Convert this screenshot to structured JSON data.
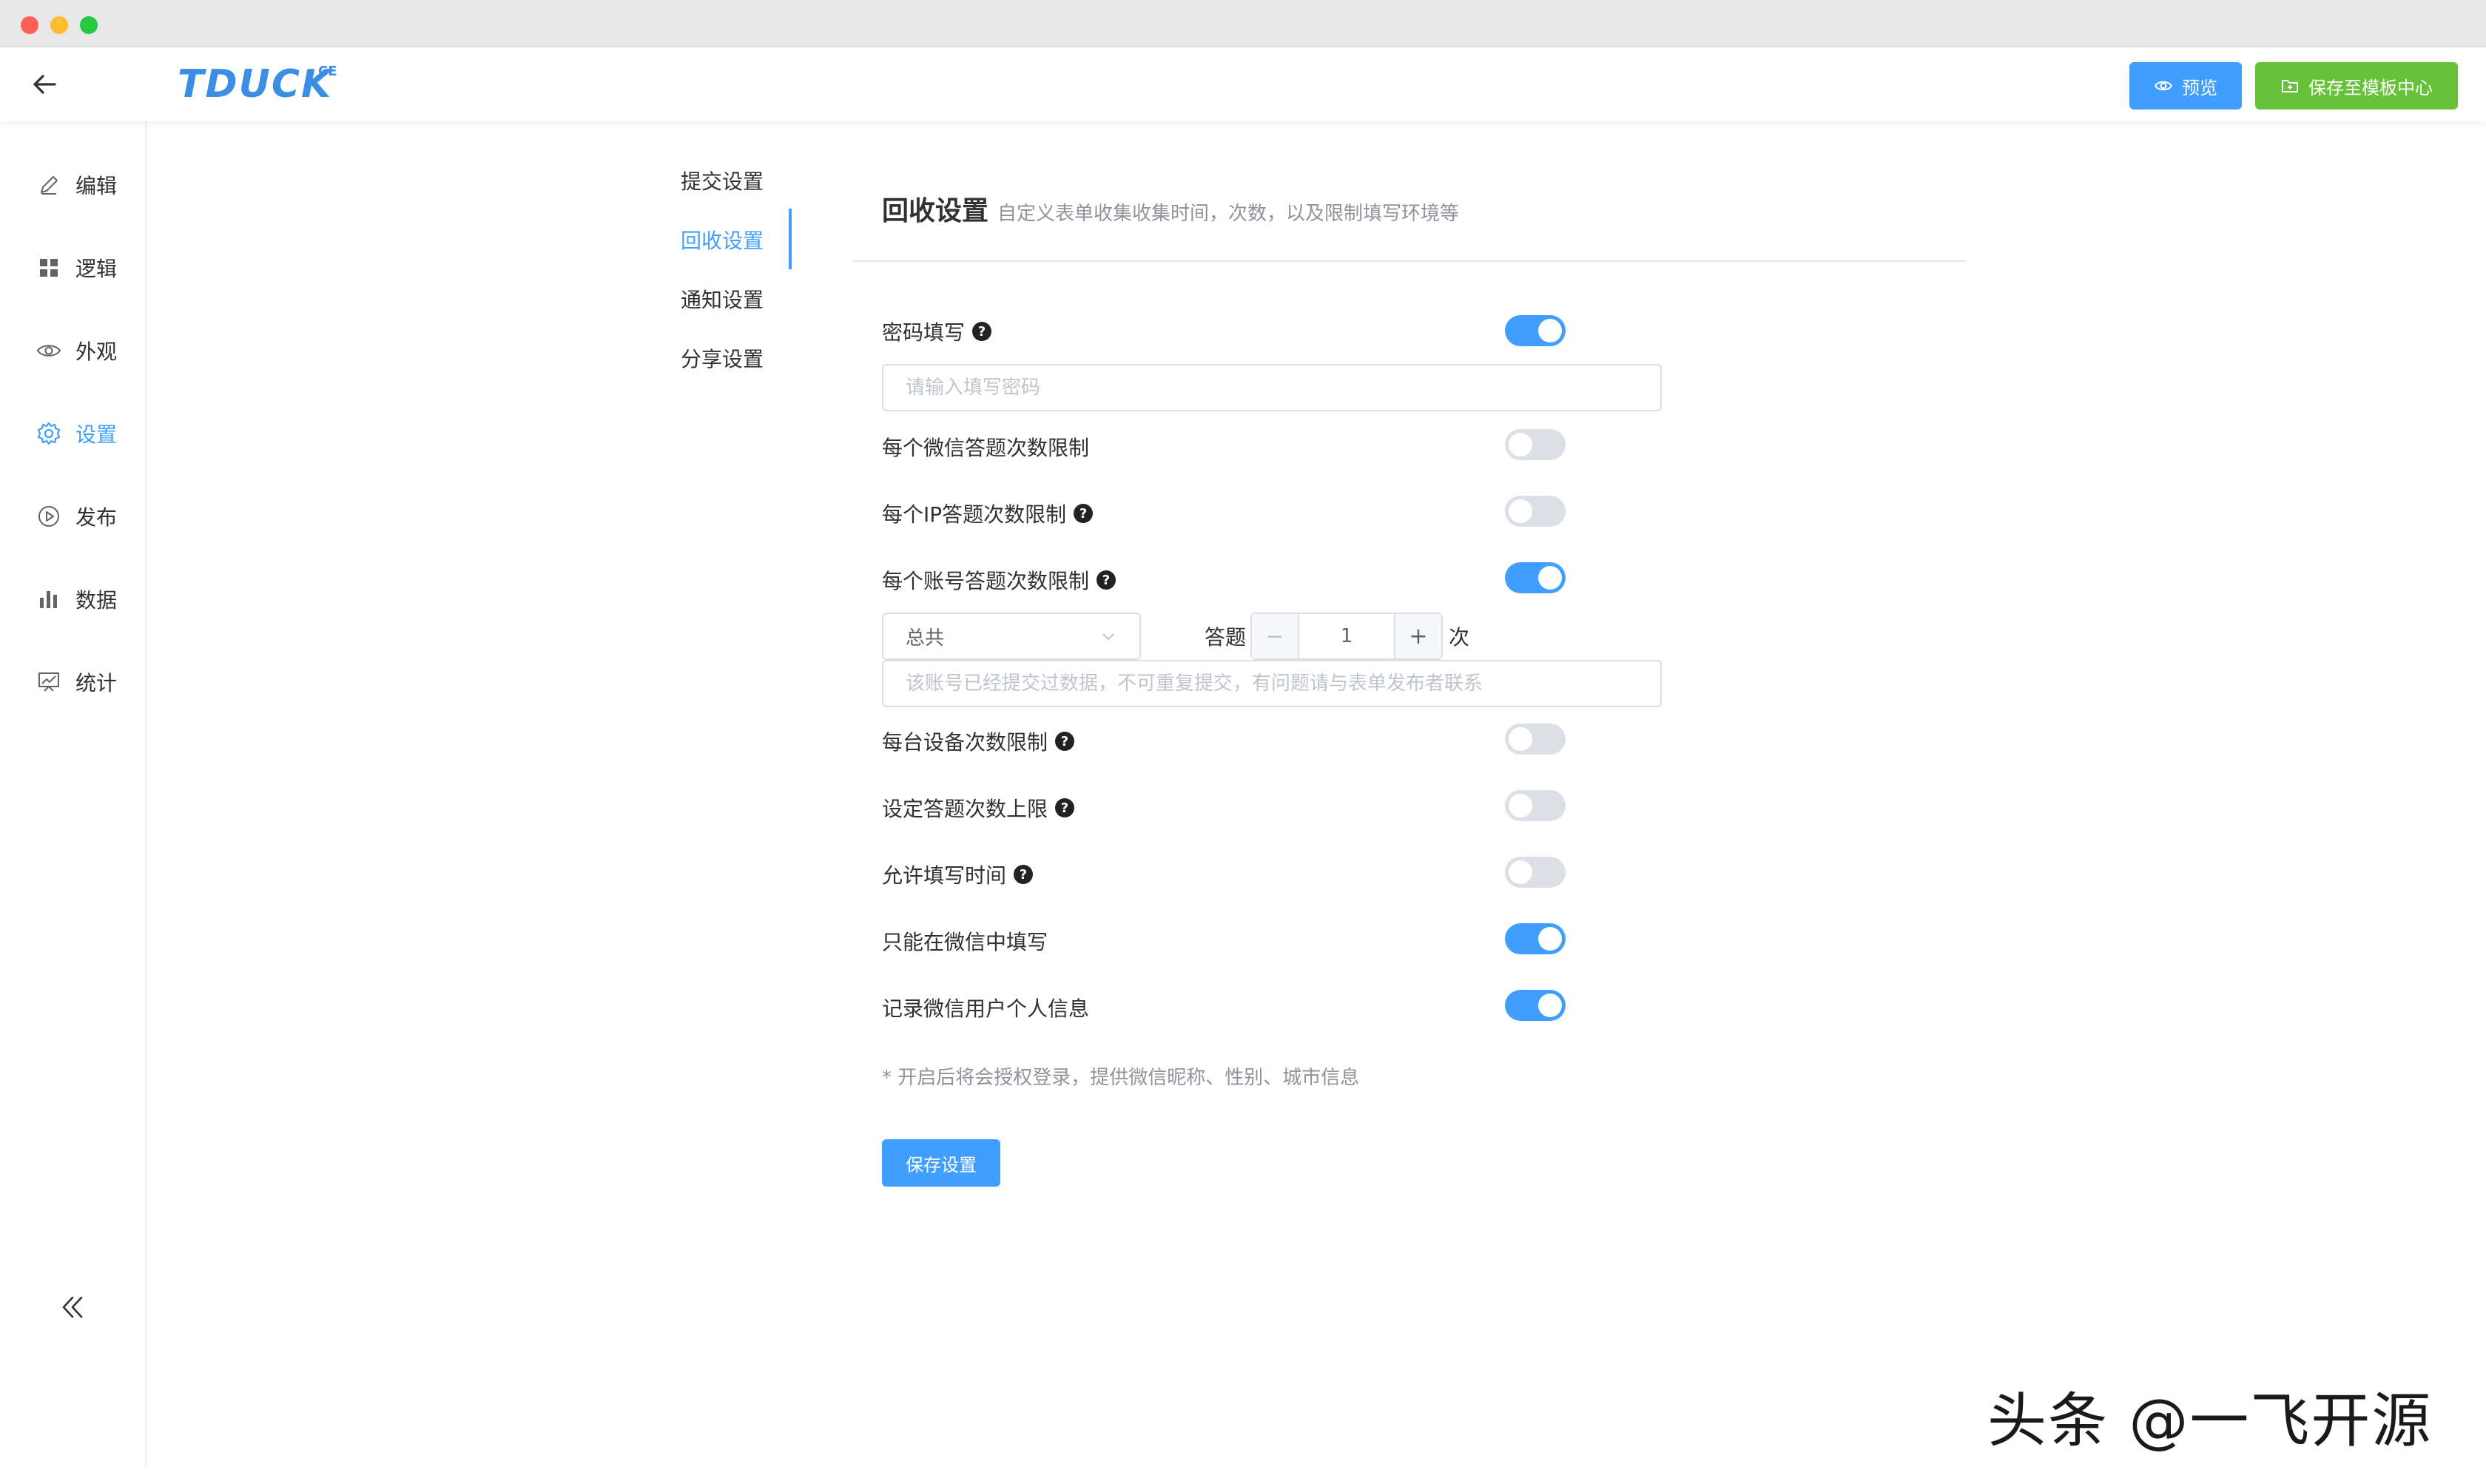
{
  "header": {
    "logo": "TDUCK",
    "logo_sup": "CE",
    "preview_label": "预览",
    "save_template_label": "保存至模板中心"
  },
  "sidebar": {
    "items": [
      {
        "label": "编辑",
        "icon": "edit-icon"
      },
      {
        "label": "逻辑",
        "icon": "grid-icon"
      },
      {
        "label": "外观",
        "icon": "eye-icon"
      },
      {
        "label": "设置",
        "icon": "gear-icon",
        "active": true
      },
      {
        "label": "发布",
        "icon": "play-circle-icon"
      },
      {
        "label": "数据",
        "icon": "bar-chart-icon"
      },
      {
        "label": "统计",
        "icon": "chart-board-icon"
      }
    ]
  },
  "subnav": {
    "items": [
      {
        "label": "提交设置"
      },
      {
        "label": "回收设置",
        "active": true
      },
      {
        "label": "通知设置"
      },
      {
        "label": "分享设置"
      }
    ]
  },
  "section": {
    "title": "回收设置",
    "desc": "自定义表单收集收集时间，次数，以及限制填写环境等"
  },
  "settings": {
    "password": {
      "label": "密码填写",
      "on": true,
      "placeholder": "请输入填写密码"
    },
    "wechat_limit": {
      "label": "每个微信答题次数限制",
      "on": false
    },
    "ip_limit": {
      "label": "每个IP答题次数限制",
      "on": false
    },
    "account_limit": {
      "label": "每个账号答题次数限制",
      "on": true,
      "period": "总共",
      "answer_label": "答题",
      "count": "1",
      "times_label": "次",
      "minus": "−",
      "plus": "+",
      "message_placeholder": "该账号已经提交过数据，不可重复提交，有问题请与表单发布者联系"
    },
    "device_limit": {
      "label": "每台设备次数限制",
      "on": false
    },
    "answer_cap": {
      "label": "设定答题次数上限",
      "on": false
    },
    "fill_time": {
      "label": "允许填写时间",
      "on": false
    },
    "wechat_only": {
      "label": "只能在微信中填写",
      "on": true
    },
    "record_wechat": {
      "label": "记录微信用户个人信息",
      "on": true
    }
  },
  "note": "* 开启后将会授权登录，提供微信昵称、性别、城市信息",
  "save_button": "保存设置",
  "watermark": "头条 @一飞开源",
  "colors": {
    "primary": "#409eff",
    "success": "#67c23a",
    "switch_off": "#dcdfe6"
  }
}
